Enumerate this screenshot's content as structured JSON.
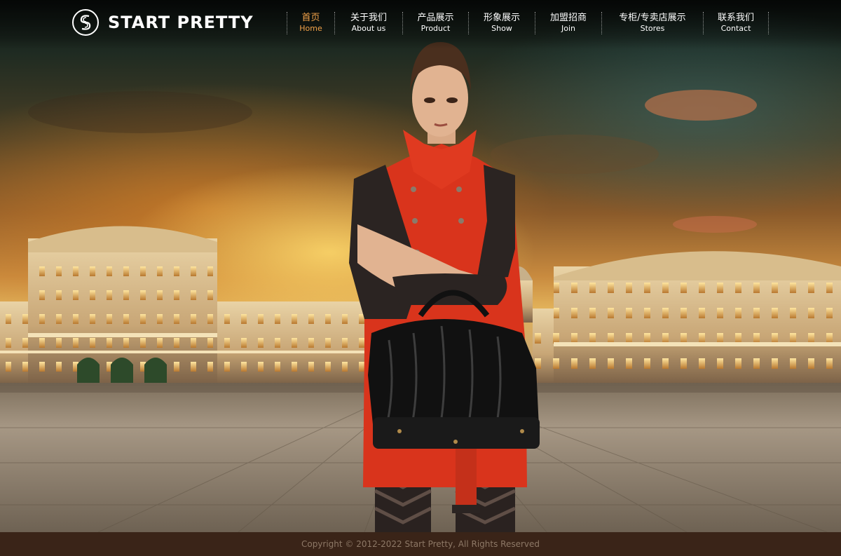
{
  "brand": {
    "name": "START PRETTY",
    "logo_icon": "ss-monogram-icon"
  },
  "nav": {
    "items": [
      {
        "cn": "首页",
        "en": "Home",
        "active": true
      },
      {
        "cn": "关于我们",
        "en": "About us",
        "active": false
      },
      {
        "cn": "产品展示",
        "en": "Product",
        "active": false
      },
      {
        "cn": "形象展示",
        "en": "Show",
        "active": false
      },
      {
        "cn": "加盟招商",
        "en": "Join",
        "active": false
      },
      {
        "cn": "专柜/专卖店展示",
        "en": "Stores",
        "active": false
      },
      {
        "cn": "联系我们",
        "en": "Contact",
        "active": false
      }
    ]
  },
  "footer": {
    "copyright": "Copyright © 2012-2022 Start Pretty, All Rights Reserved"
  },
  "colors": {
    "nav_active": "#f3a34a",
    "nav_text": "#ffffff",
    "footer_bg": "#3a2418",
    "footer_text": "#8d7866",
    "coat": "#d9341c"
  }
}
